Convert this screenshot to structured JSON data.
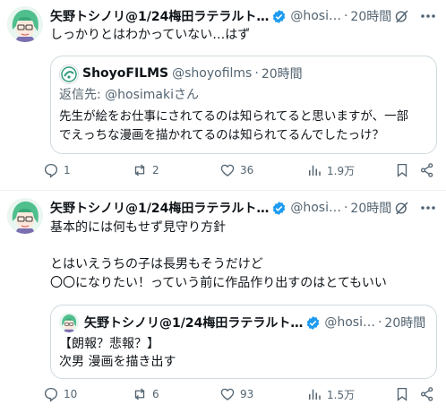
{
  "tweet1": {
    "author_name": "矢野トシノリ@1/24梅田ラテラルト…",
    "handle": "@hosi…",
    "sep": "·",
    "time": "20時間",
    "text": "しっかりとはわかっていない…はず",
    "quote": {
      "author_name": "ShoyoFILMS",
      "handle": "@shoyofilms",
      "sep": "·",
      "time": "20時間",
      "reply_to": "返信先: @hosimakiさん",
      "text": "先生が絵をお仕事にされてるのは知られてると思いますが、一部\nでえっちな漫画を描かれてるのは知られてるんでしたっけ？"
    },
    "actions": {
      "replies": "1",
      "reposts": "2",
      "likes": "36",
      "views": "1.9万"
    }
  },
  "tweet2": {
    "author_name": "矢野トシノリ@1/24梅田ラテラルト…",
    "handle": "@hosi…",
    "sep": "·",
    "time": "20時間",
    "text": "基本的には何もせず見守り方針\n\nとはいえうちの子は長男もそうだけど\n〇〇になりたい！っていう前に作品作り出すのはとてもいい",
    "quote": {
      "author_name": "矢野トシノリ@1/24梅田ラテラルト…",
      "handle": "@hosi…",
      "sep": "·",
      "time": "20時間",
      "text": "【朗報？悲報？】\n次男 漫画を描き出す"
    },
    "actions": {
      "replies": "10",
      "reposts": "6",
      "likes": "93",
      "views": "1.5万"
    }
  },
  "colors": {
    "verified": "#1d9bf0",
    "secondary_text": "#536471",
    "border": "#cfd9de"
  }
}
